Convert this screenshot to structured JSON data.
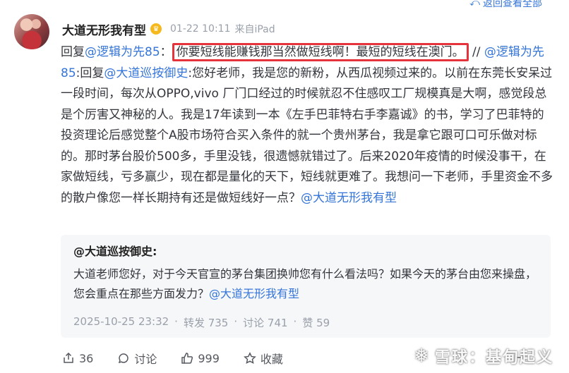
{
  "top_link": {
    "label": "返回查看全部",
    "icon": "return-arrow-icon"
  },
  "post": {
    "username": "大道无形我有型",
    "verified_icon": "crown-badge-icon",
    "time": "01-22 10:11",
    "source": "来自iPad",
    "reply_prefix": "回复",
    "reply_to": "@逻辑为先85",
    "colon": "：",
    "highlighted_text": "你要短线能赚钱那当然做短线啊！最短的短线在澳门。",
    "sep": " // ",
    "mention_2": "@逻辑为先85",
    "reply_mid": ":回复",
    "mention_3": "@大道巡按御史",
    "body": ":您好老师，我是您的新粉，从西瓜视频过来的。以前在东莞长安呆过一段时间，每次从OPPO,vivo 厂门口经过的时候就忍不住感叹工厂规模真是大啊，感觉段总是个厉害又神秘的人。我是17年读到一本《左手巴菲特右手李嘉诚》的书，学习了巴菲特的投资理论后感觉整个A股市场符合买入条件的就一个贵州茅台，我是拿它跟可口可乐做对标的。那时茅台股价500多，手里没钱，很遗憾就错过了。后来2020年疫情的时候没事干，在家做短线，亏多赢少，现在都是量化的天下，短线就更难了。我想问一下老师，手里资金不多的散户像您一样长期持有还是做短线好一点？",
    "mention_4": "@大道无形我有型"
  },
  "quote": {
    "author": "@大道巡按御史:",
    "text": "大道老师您好，对于今天官宣的茅台集团换帅您有什么看法吗？如果今天的茅台由您来操盘，您会重点在那些方面发力？",
    "mention": "@大道无形我有型",
    "date": "2025-10-25 23:32",
    "dot": "·",
    "repost": "转发 735",
    "comment": "讨论 741",
    "like": "赞 59"
  },
  "actions": {
    "share_count": "36",
    "comment_label": "讨论",
    "like_count": "999",
    "favorite_label": "收藏"
  },
  "watermark": "雪球：基甸起义",
  "colors": {
    "link": "#3575d9",
    "highlight_border": "#e6323a",
    "quote_bg": "#f6f7f9"
  }
}
